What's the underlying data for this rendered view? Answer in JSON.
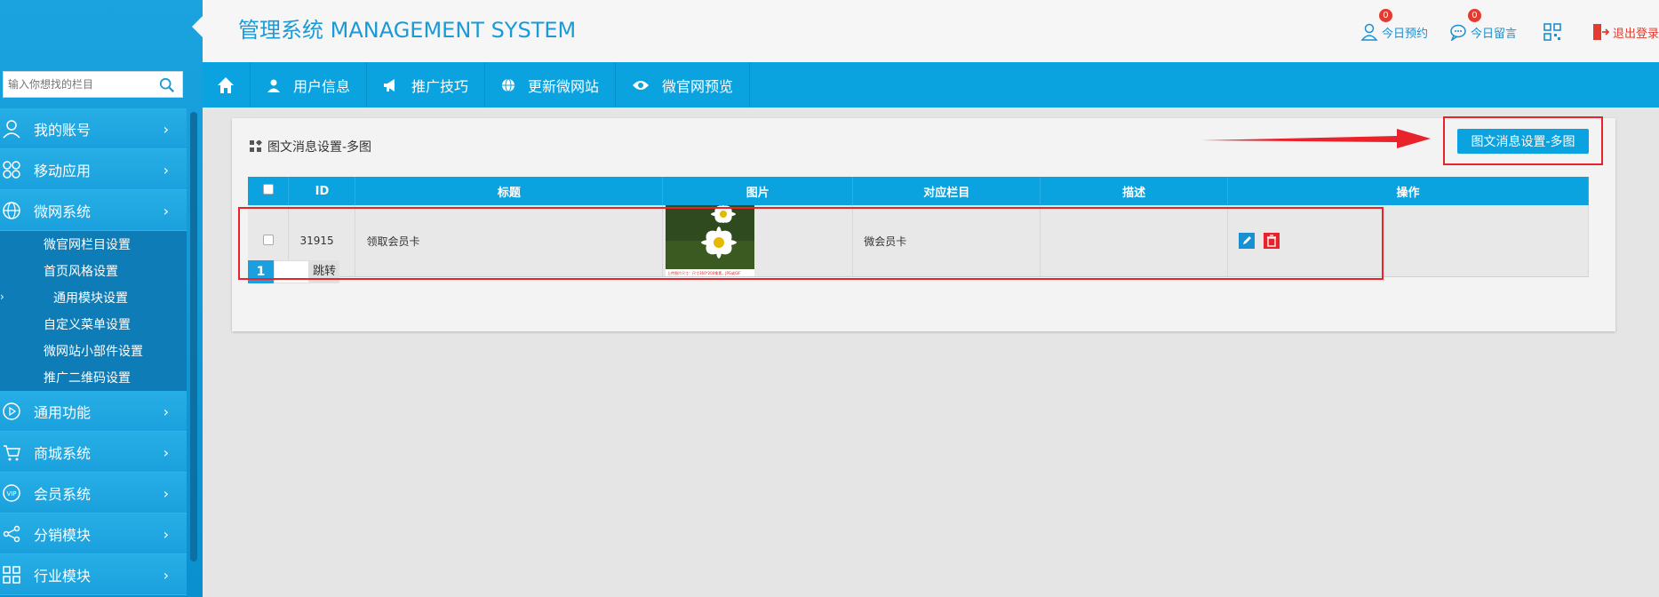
{
  "header": {
    "title": "管理系统 MANAGEMENT SYSTEM",
    "links": [
      {
        "label": "今日预约",
        "badge": "0",
        "icon": "user-icon"
      },
      {
        "label": "今日留言",
        "badge": "0",
        "icon": "chat-icon"
      },
      {
        "label": "",
        "icon": "qrcode-icon"
      },
      {
        "label": "退出登录",
        "icon": "logout-icon"
      }
    ]
  },
  "sidebar": {
    "search": {
      "placeholder": "输入你想找的栏目"
    },
    "items": [
      {
        "label": "我的账号",
        "icon": "user-icon"
      },
      {
        "label": "移动应用",
        "icon": "apps-icon"
      },
      {
        "label": "微网系统",
        "icon": "globe-icon"
      },
      {
        "label": "通用功能",
        "icon": "play-icon"
      },
      {
        "label": "商城系统",
        "icon": "cart-icon"
      },
      {
        "label": "会员系统",
        "icon": "vip-icon"
      },
      {
        "label": "分销模块",
        "icon": "share-icon"
      },
      {
        "label": "行业模块",
        "icon": "grid-icon"
      }
    ],
    "submenu": [
      {
        "label": "微官网栏目设置"
      },
      {
        "label": "首页风格设置"
      },
      {
        "label": "通用模块设置",
        "active": true
      },
      {
        "label": "自定义菜单设置"
      },
      {
        "label": "微网站小部件设置"
      },
      {
        "label": "推广二维码设置"
      }
    ]
  },
  "topnav": {
    "items": [
      {
        "label": "用户信息",
        "icon": "user-icon"
      },
      {
        "label": "推广技巧",
        "icon": "megaphone-icon"
      },
      {
        "label": "更新微网站",
        "icon": "globe-icon"
      },
      {
        "label": "微官网预览",
        "icon": "eye-icon"
      }
    ]
  },
  "panel": {
    "title": "图文消息设置-多图",
    "primary_button": "图文消息设置-多图"
  },
  "table": {
    "columns": [
      "ID",
      "标题",
      "图片",
      "对应栏目",
      "描述",
      "操作"
    ],
    "rows": [
      {
        "id": "31915",
        "title": "领取会员卡",
        "image_caption": "上传图片尺寸：尺寸360*200像素，JPG或GIF",
        "column": "微会员卡",
        "description": ""
      }
    ]
  },
  "pager": {
    "current": "1",
    "jump_label": "跳转"
  },
  "colors": {
    "primary": "#0aa3e0",
    "danger": "#e8232b",
    "brand_text": "#1a9ad7"
  }
}
